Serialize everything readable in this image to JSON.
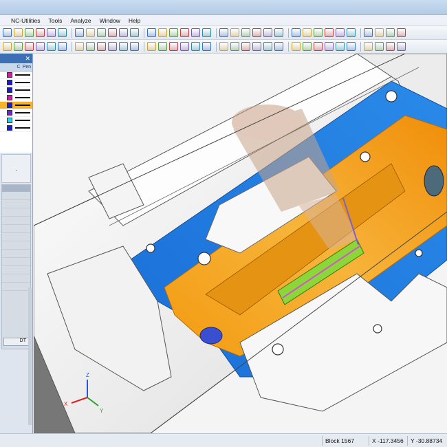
{
  "menu": [
    "NC-Utilities",
    "Tools",
    "Analyze",
    "Window",
    "Help"
  ],
  "toolbar_icons": [
    "edit-icon",
    "print-icon",
    "pointer-icon",
    "select-icon",
    "grid-icon",
    "view-icon",
    "layer-icon",
    "light-icon",
    "zoom-icon",
    "plus-icon",
    "move-icon",
    "shape-icon",
    "measure-icon",
    "copy-icon",
    "arrow-icon",
    "rotate-icon",
    "lock-icon",
    "surface-icon",
    "curve-icon",
    "save-icon"
  ],
  "layer_panel": {
    "close_glyph": "✕",
    "columns": [
      "C",
      "Pen"
    ],
    "rows": [
      {
        "color": "#d21ca8",
        "line": "#111111"
      },
      {
        "color": "#1a1ad1",
        "line": "#111111"
      },
      {
        "color": "#1a1ad1",
        "line": "#111111"
      },
      {
        "color": "#d21ca8",
        "line": "#111111"
      },
      {
        "color": "#1a1ad1",
        "line": "#111111",
        "selected": true
      },
      {
        "color": "#6a2ac0",
        "line": "#111111"
      },
      {
        "color": "#1fd6e8",
        "line": "#111111"
      },
      {
        "color": "#1a1ad1",
        "line": "#111111"
      }
    ]
  },
  "side_field_value": ".",
  "tree_footer": "DT",
  "status": {
    "block": "Block 1567",
    "x_label": "X",
    "x_value": "-117.3456",
    "y_label": "Y",
    "y_value": "-30.88734"
  },
  "axis_labels": {
    "x": "X",
    "y": "Y",
    "z": "Z"
  },
  "colors": {
    "accent": "#3c6fb4",
    "machined_orange": "#f5a318",
    "toolpath_blue": "#1e7be0",
    "floor_green": "#8cd63a"
  }
}
